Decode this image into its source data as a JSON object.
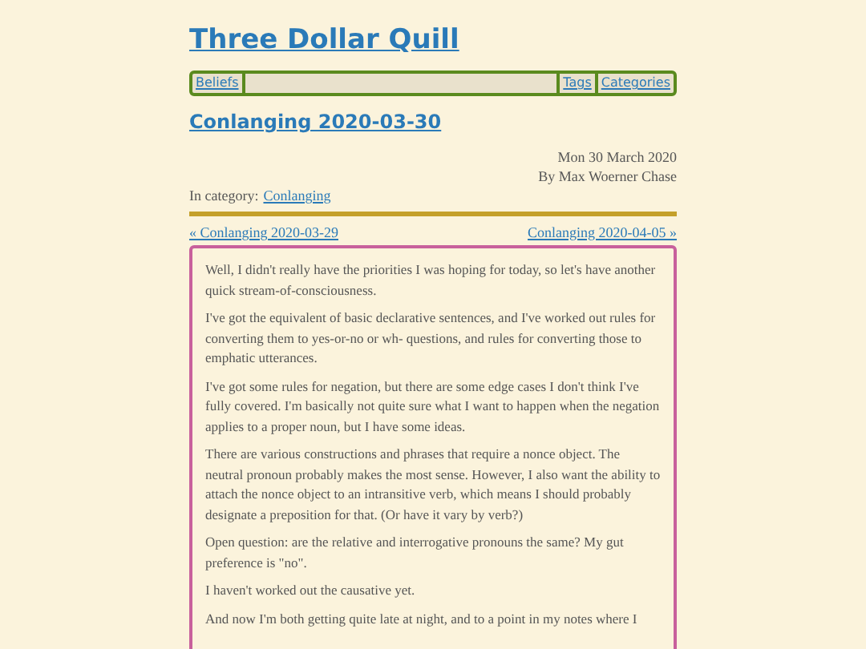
{
  "site_title": "Three Dollar Quill",
  "nav": {
    "left": [
      "Beliefs"
    ],
    "right": [
      "Tags",
      "Categories"
    ]
  },
  "post": {
    "title": "Conlanging 2020-03-30",
    "date": "Mon 30 March 2020",
    "author": "By Max Woerner Chase",
    "category_label": "In category:",
    "category": "Conlanging",
    "prev": "« Conlanging 2020-03-29",
    "next": "Conlanging 2020-04-05 »",
    "paragraphs": [
      "Well, I didn't really have the priorities I was hoping for today, so let's have another quick stream-of-consciousness.",
      "I've got the equivalent of basic declarative sentences, and I've worked out rules for converting them to yes-or-no or wh- questions, and rules for converting those to emphatic utterances.",
      "I've got some rules for negation, but there are some edge cases I don't think I've fully covered. I'm basically not quite sure what I want to happen when the negation applies to a proper noun, but I have some ideas.",
      "There are various constructions and phrases that require a nonce object. The neutral pronoun probably makes the most sense. However, I also want the ability to attach the nonce object to an intransitive verb, which means I should probably designate a preposition for that. (Or have it vary by verb?)",
      "Open question: are the relative and interrogative pronouns the same? My gut preference is \"no\".",
      "I haven't worked out the causative yet.",
      "And now I'm both getting quite late at night, and to a point in my notes where I"
    ]
  }
}
